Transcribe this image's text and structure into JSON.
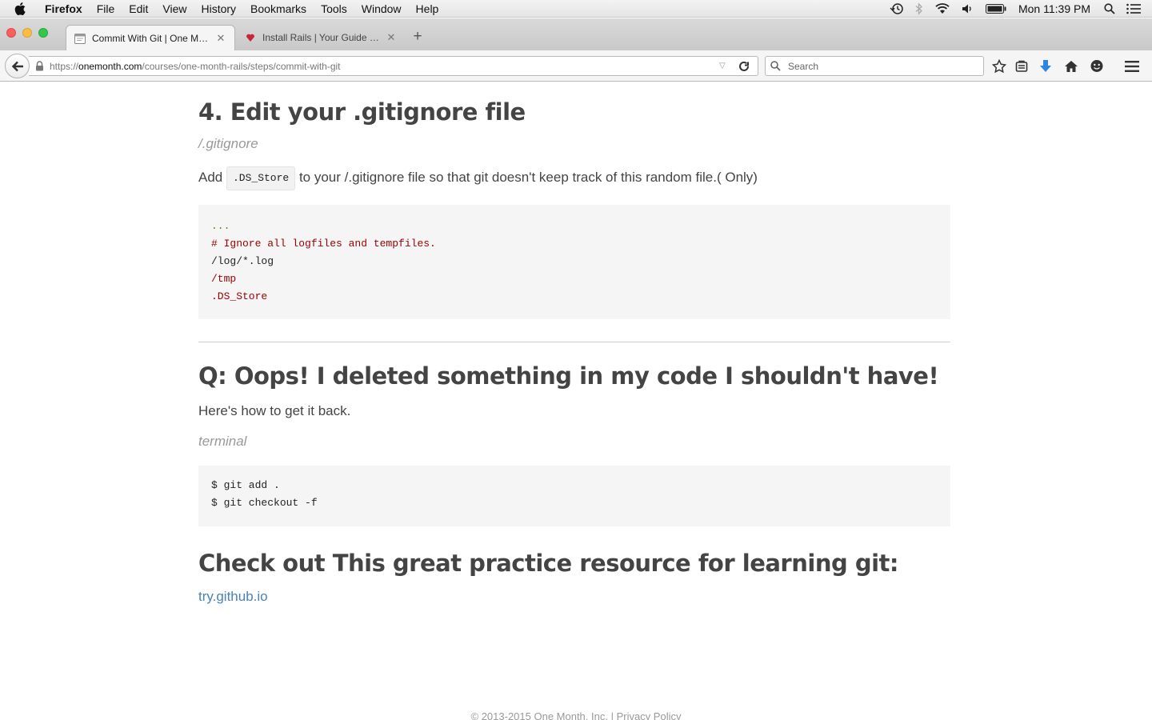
{
  "menubar": {
    "app": "Firefox",
    "items": [
      "File",
      "Edit",
      "View",
      "History",
      "Bookmarks",
      "Tools",
      "Window",
      "Help"
    ],
    "clock": "Mon 11:39 PM"
  },
  "tabs": [
    {
      "title": "Commit With Git | One Mon...",
      "active": true
    },
    {
      "title": "Install Rails | Your Guide for...",
      "active": false
    }
  ],
  "navbar": {
    "url_prefix": "https://",
    "url_host": "onemonth.com",
    "url_path": "/courses/one-month-rails/steps/commit-with-git",
    "search_placeholder": "Search"
  },
  "content": {
    "section4": {
      "heading": "4. Edit your .gitignore file",
      "caption": "/.gitignore",
      "para_before": "Add",
      "inline_code": ".DS_Store",
      "para_after": "to your /.gitignore file so that git doesn't keep track of this random file.( Only)",
      "code_lines": [
        {
          "text": "...",
          "color": "#7a7a00"
        },
        {
          "text": "# Ignore all logfiles and tempfiles.",
          "color": "#990000"
        },
        {
          "text": "/log/*.log",
          "color": "#222222"
        },
        {
          "text": "/tmp",
          "color": "#990000"
        },
        {
          "text": ".DS_Store",
          "color": "#990000"
        }
      ]
    },
    "section_q": {
      "heading": "Q: Oops! I deleted something in my code I shouldn't have!",
      "para": "Here's how to get it back.",
      "caption": "terminal",
      "code_lines": [
        "$ git add .",
        "$ git checkout -f"
      ]
    },
    "section_resource": {
      "heading": "Check out This great practice resource for learning git:",
      "link": "try.github.io"
    },
    "footer": "© 2013-2015 One Month, Inc. | Privacy Policy"
  },
  "colors": {
    "link": "#4a82b8",
    "download_arrow": "#2c86e0",
    "heading": "#444444"
  }
}
